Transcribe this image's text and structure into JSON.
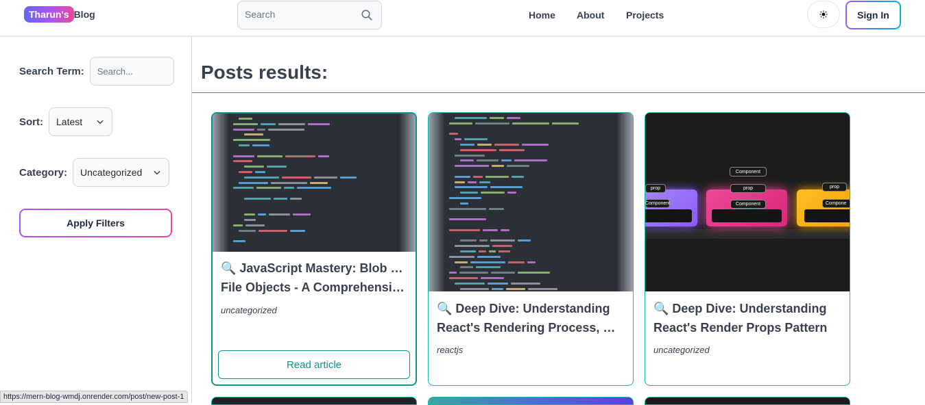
{
  "header": {
    "logo_badge": "Tharun's",
    "logo_text": "Blog",
    "search_placeholder": "Search",
    "nav": [
      "Home",
      "About",
      "Projects"
    ],
    "theme_icon": "moon-icon",
    "signin_label": "Sign In"
  },
  "sidebar": {
    "search_label": "Search Term:",
    "search_placeholder": "Search...",
    "sort_label": "Sort:",
    "sort_value": "Latest",
    "category_label": "Category:",
    "category_value": "Uncategorized",
    "apply_label": "Apply Filters"
  },
  "main": {
    "title": "Posts results:",
    "posts": [
      {
        "title_line1": "🔍 JavaScript Mastery: Blob vs.",
        "title_line2": "File Objects - A Comprehensive...",
        "category": "uncategorized",
        "read_label": "Read article"
      },
      {
        "title_line1": "🔍 Deep Dive: Understanding",
        "title_line2": "React's Rendering Process, Stat...",
        "category": "reactjs"
      },
      {
        "title_line1": "🔍 Deep Dive: Understanding",
        "title_line2": "React's Render Props Pattern",
        "category": "uncategorized"
      }
    ],
    "diagram": {
      "top_node": "Component",
      "prop": "prop",
      "inner": "Component",
      "left_inner": "Component",
      "right_inner": "Compone"
    }
  },
  "status_bar": {
    "url": "https://mern-blog-wmdj.onrender.com/post/new-post-1"
  }
}
